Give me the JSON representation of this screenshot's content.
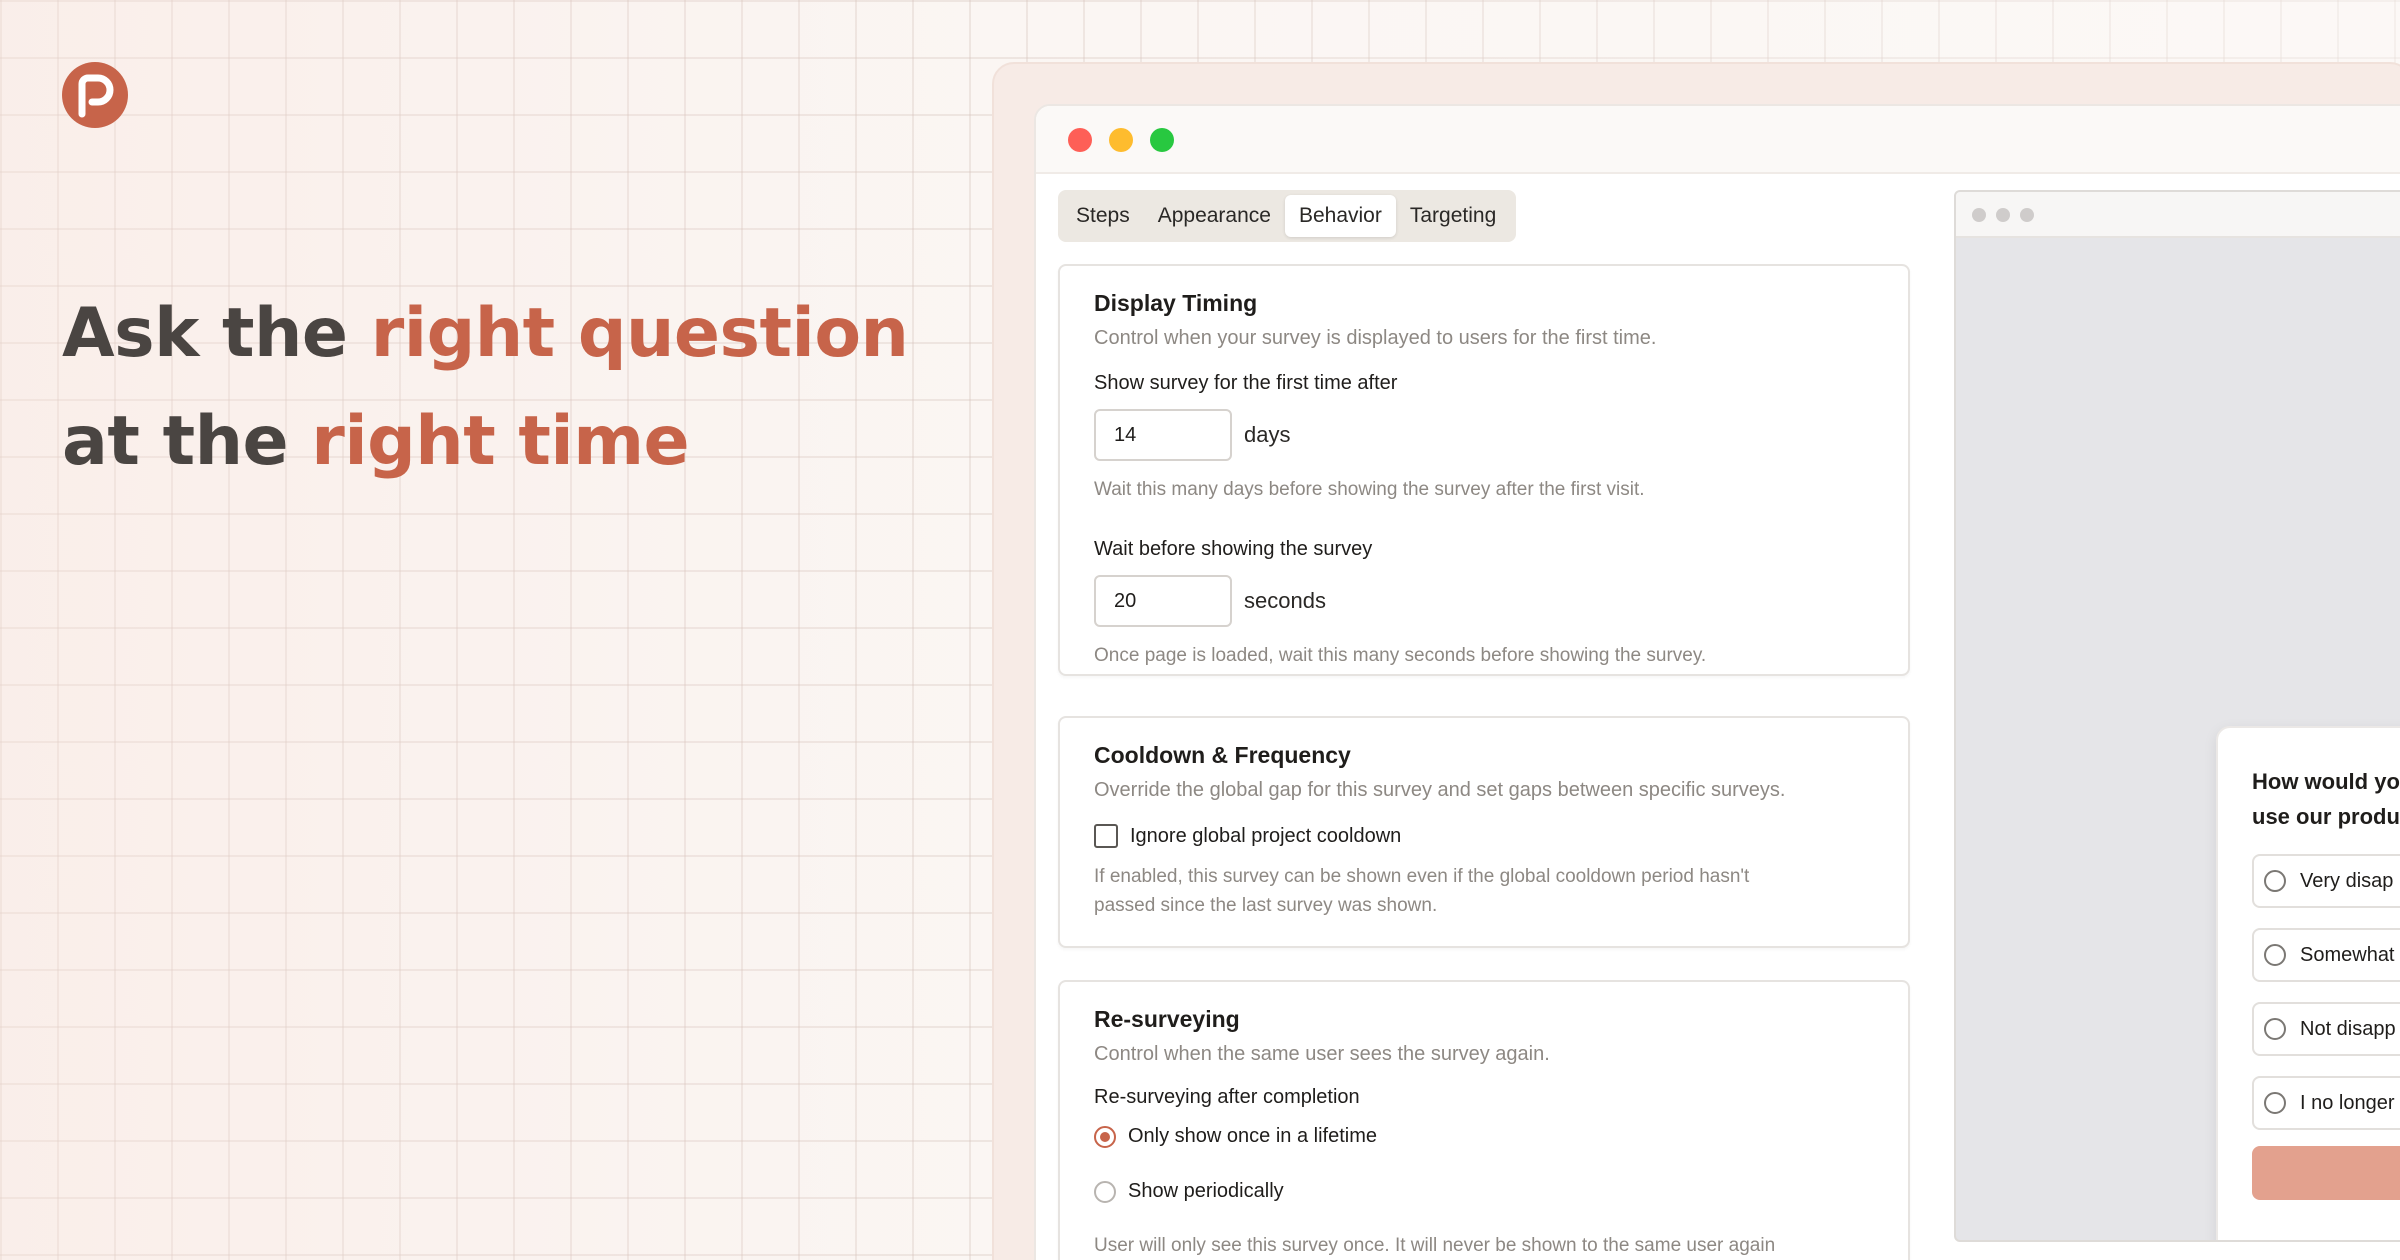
{
  "headline": {
    "line1_prefix": "Ask the ",
    "line1_accent": "right question",
    "line2_prefix": "at the ",
    "line2_accent": "right time"
  },
  "colors": {
    "accent": "#c7644a",
    "window_close": "#fe5f57",
    "window_minimize": "#febc2e",
    "window_zoom": "#28c840"
  },
  "tabs": [
    {
      "label": "Steps",
      "active": false
    },
    {
      "label": "Appearance",
      "active": false
    },
    {
      "label": "Behavior",
      "active": true
    },
    {
      "label": "Targeting",
      "active": false
    }
  ],
  "display_timing": {
    "title": "Display Timing",
    "description": "Control when your survey is displayed to users for the first time.",
    "first_time_label": "Show survey for the first time after",
    "first_time_value": "14",
    "first_time_unit": "days",
    "first_time_hint": "Wait this many days before showing the survey after the first visit.",
    "wait_label": "Wait before showing the survey",
    "wait_value": "20",
    "wait_unit": "seconds",
    "wait_hint": "Once page is loaded, wait this many seconds before showing the survey."
  },
  "cooldown": {
    "title": "Cooldown & Frequency",
    "description": "Override the global gap for this survey and set gaps between specific surveys.",
    "ignore_label": "Ignore global project cooldown",
    "ignore_checked": false,
    "hint_line1": "If enabled, this survey can be shown even if the global cooldown period hasn't",
    "hint_line2": "passed since the last survey was shown."
  },
  "resurveying": {
    "title": "Re-surveying",
    "description": "Control when the same user sees the survey again.",
    "after_label": "Re-surveying after completion",
    "option_once": "Only show once in a lifetime",
    "option_periodic": "Show periodically",
    "selected": "once",
    "hint": "User will only see this survey once. It will never be shown to the same user again"
  },
  "survey_preview": {
    "question_line1": "How would yo",
    "question_line2": "use our produ",
    "options": [
      "Very disap",
      "Somewhat",
      "Not disapp",
      "I no longer"
    ]
  }
}
